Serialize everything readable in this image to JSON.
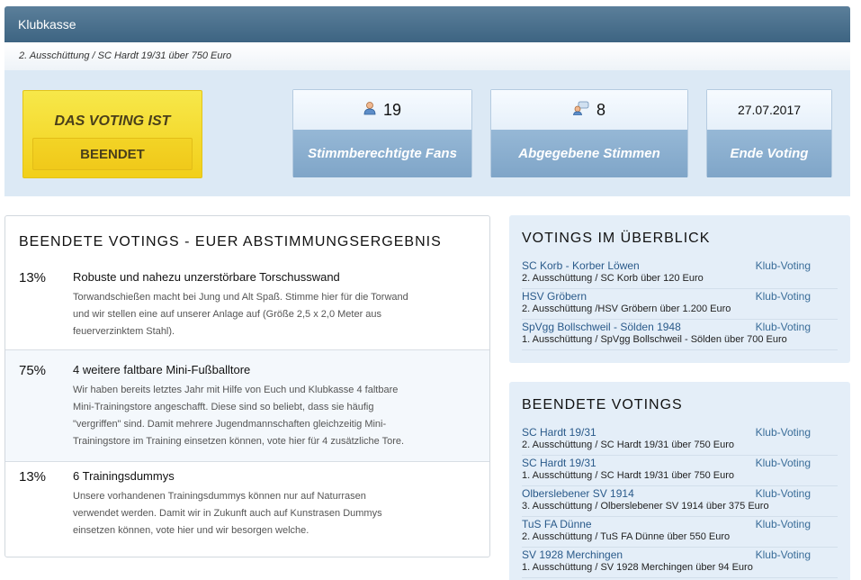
{
  "header": {
    "title": "Klubkasse",
    "subtitle": "2. Ausschüttung / SC Hardt 19/31 über 750 Euro"
  },
  "voting_status": {
    "line1": "DAS VOTING IST",
    "line2": "BEENDET"
  },
  "stats": [
    {
      "value": "19",
      "label": "Stimmberechtigte Fans",
      "icon": "user-icon"
    },
    {
      "value": "8",
      "label": "Abgegebene Stimmen",
      "icon": "speech-bubble-icon"
    },
    {
      "value": "27.07.2017",
      "label": "Ende Voting"
    }
  ],
  "results": {
    "heading": "BEENDETE VOTINGS - EUER ABSTIMMUNGSERGEBNIS",
    "options": [
      {
        "percent": "13%",
        "title": "Robuste und nahezu unzerstörbare Torschusswand",
        "lines": [
          "Torwandschießen macht bei Jung und Alt Spaß. Stimme hier für die Torwand",
          "und wir stellen eine auf unserer Anlage auf (Größe 2,5 x 2,0 Meter aus",
          "feuerverzinktem Stahl)."
        ]
      },
      {
        "percent": "75%",
        "title": "4 weitere faltbare Mini-Fußballtore",
        "lines": [
          "Wir haben bereits letztes Jahr mit Hilfe von Euch und Klubkasse 4 faltbare",
          "Mini-Trainingstore angeschafft. Diese sind so beliebt, dass sie häufig",
          "\"vergriffen\" sind. Damit mehrere Jugendmannschaften gleichzeitig Mini-",
          "Trainingstore im Training einsetzen können, vote hier für 4 zusätzliche Tore."
        ]
      },
      {
        "percent": "13%",
        "title": "6 Trainingsdummys",
        "lines": [
          "Unsere vorhandenen Trainingsdummys können nur auf Naturrasen",
          "verwendet werden. Damit wir in Zukunft auch auf Kunstrasen Dummys",
          "einsetzen können, vote hier und wir besorgen welche."
        ]
      }
    ]
  },
  "overview": {
    "heading": "VOTINGS IM ÜBERBLICK",
    "entries": [
      {
        "name": "SC Korb - Korber Löwen",
        "kind": "Klub-Voting",
        "line": "2. Ausschüttung / SC Korb über 120 Euro"
      },
      {
        "name": "HSV Gröbern",
        "kind": "Klub-Voting",
        "line": "2. Ausschüttung /HSV Gröbern über 1.200 Euro"
      },
      {
        "name": "SpVgg Bollschweil - Sölden 1948",
        "kind": "Klub-Voting",
        "line": "1. Ausschüttung / SpVgg Bollschweil - Sölden über 700 Euro"
      }
    ]
  },
  "finished": {
    "heading": "BEENDETE VOTINGS",
    "entries": [
      {
        "name": "SC Hardt 19/31",
        "kind": "Klub-Voting",
        "line": "2. Ausschüttung / SC Hardt 19/31 über 750 Euro"
      },
      {
        "name": "SC Hardt 19/31",
        "kind": "Klub-Voting",
        "line": "1. Ausschüttung / SC Hardt 19/31 über 750 Euro"
      },
      {
        "name": "Olberslebener SV 1914",
        "kind": "Klub-Voting",
        "line": "3. Ausschüttung / Olberslebener SV 1914 über 375 Euro"
      },
      {
        "name": "TuS FA Dünne",
        "kind": "Klub-Voting",
        "line": "2. Ausschüttung / TuS FA Dünne über 550 Euro"
      },
      {
        "name": "SV 1928 Merchingen",
        "kind": "Klub-Voting",
        "line": "1. Ausschüttung / SV 1928 Merchingen über 94 Euro"
      }
    ]
  }
}
